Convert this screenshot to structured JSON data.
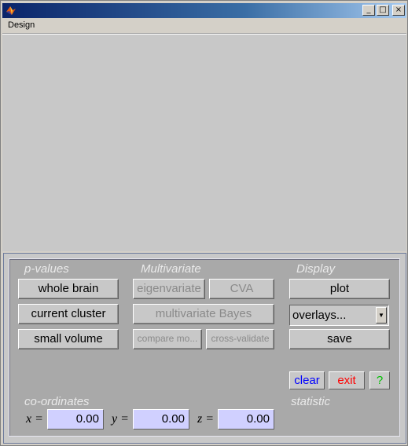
{
  "menu": {
    "design_label": "Design"
  },
  "window_controls": {
    "minimize": "_",
    "maximize": "□",
    "close": "×"
  },
  "sections": {
    "pvalues": "p-values",
    "multivariate": "Multivariate",
    "display": "Display",
    "coordinates": "co-ordinates",
    "statistic": "statistic"
  },
  "pvalues_buttons": {
    "whole_brain": "whole brain",
    "current_cluster": "current cluster",
    "small_volume": "small volume"
  },
  "multivariate_buttons": {
    "eigenvariate": "eigenvariate",
    "cva": "CVA",
    "multivariate_bayes": "multivariate Bayes",
    "compare_models": "compare mo...",
    "cross_validate": "cross-validate"
  },
  "display_buttons": {
    "plot": "plot",
    "overlays": "overlays...",
    "save": "save"
  },
  "tools": {
    "clear": "clear",
    "exit": "exit",
    "help": "?"
  },
  "colors": {
    "clear": "#0000ff",
    "exit": "#ff0000",
    "help": "#00c000",
    "input_bg": "#d0d0ff",
    "panel_bg": "#a9a9a9"
  },
  "coordinates": {
    "x_label": "x =",
    "y_label": "y =",
    "z_label": "z =",
    "x": "0.00",
    "y": "0.00",
    "z": "0.00"
  }
}
